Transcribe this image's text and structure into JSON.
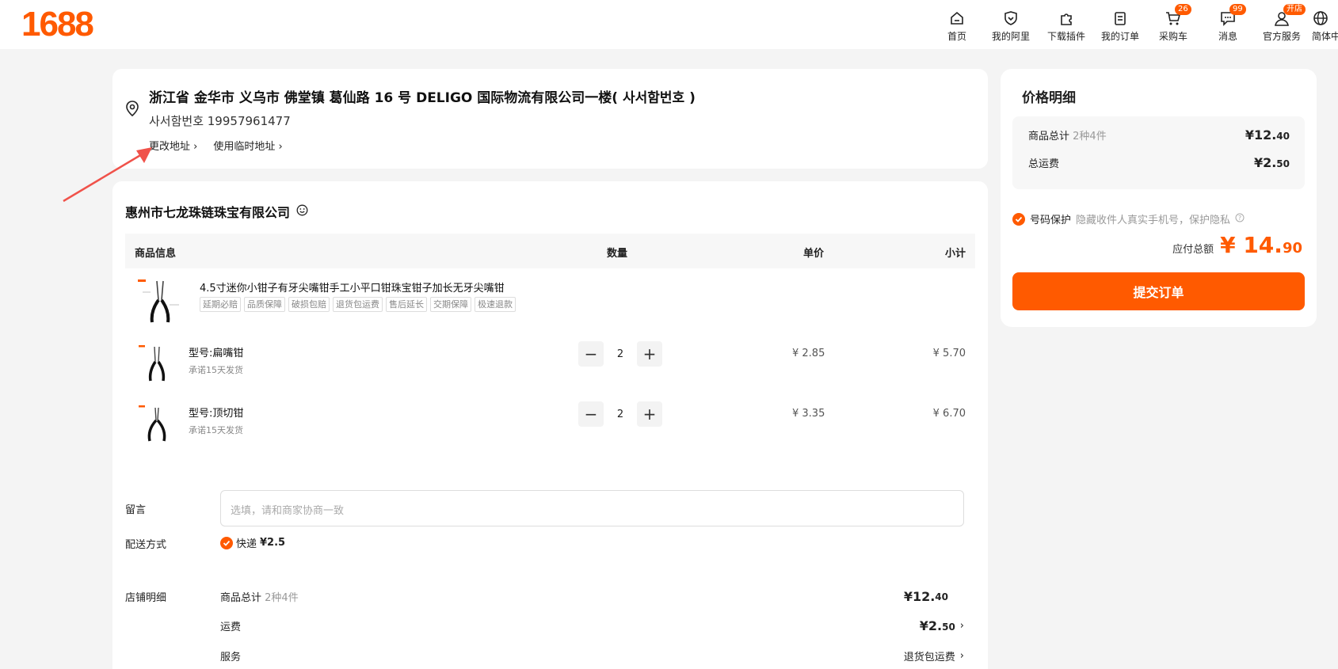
{
  "header": {
    "logo": "1688",
    "nav": [
      {
        "label": "首页",
        "icon": "home-icon"
      },
      {
        "label": "我的阿里",
        "icon": "heart-shield-icon"
      },
      {
        "label": "下载插件",
        "icon": "puzzle-icon"
      },
      {
        "label": "我的订单",
        "icon": "clipboard-icon"
      },
      {
        "label": "采购车",
        "icon": "cart-icon",
        "badge": "26"
      },
      {
        "label": "消息",
        "icon": "message-icon",
        "badge": "99"
      },
      {
        "label": "官方服务",
        "icon": "user-service-icon",
        "badge": "开店"
      },
      {
        "label": "简体中",
        "icon": "globe-icon"
      }
    ]
  },
  "address": {
    "full": "浙江省 金华市 义乌市 佛堂镇 葛仙路 16 号 DELIGO 国际物流有限公司一楼( 사서함번호 )",
    "contact": "사서함번호 19957961477",
    "change_link": "更改地址 ›",
    "temp_link": "使用临时地址 ›"
  },
  "shop": {
    "name": "惠州市七龙珠链珠宝有限公司",
    "columns": {
      "info": "商品信息",
      "qty": "数量",
      "unit": "单价",
      "subtotal": "小计"
    },
    "product": {
      "title": "4.5寸迷你小钳子有牙尖嘴钳手工小平口钳珠宝钳子加长无牙尖嘴钳",
      "tags": [
        "延期必赔",
        "品质保障",
        "破损包赔",
        "退货包运费",
        "售后延长",
        "交期保障",
        "极速退款"
      ]
    },
    "skus": [
      {
        "name": "型号:扁嘴钳",
        "promise": "承诺15天发货",
        "qty": "2",
        "unit_price": "¥ 2.85",
        "subtotal": "¥ 5.70"
      },
      {
        "name": "型号:顶切钳",
        "promise": "承诺15天发货",
        "qty": "2",
        "unit_price": "¥ 3.35",
        "subtotal": "¥ 6.70"
      }
    ],
    "note_label": "留言",
    "note_placeholder": "选填，请和商家协商一致",
    "shipping_label": "配送方式",
    "shipping_option": "快递",
    "shipping_price": "¥2.5",
    "detail_label": "店铺明细",
    "detail": {
      "goods_label": "商品总计",
      "goods_count": "2种4件",
      "goods_total_main": "¥12.",
      "goods_total_dec": "40",
      "freight_label": "运费",
      "freight_main": "¥2.",
      "freight_dec": "50",
      "service_label": "服务",
      "service_value": "退货包运费"
    }
  },
  "price_panel": {
    "title": "价格明细",
    "goods_label": "商品总计",
    "goods_count": "2种4件",
    "goods_main": "¥12.",
    "goods_dec": "40",
    "freight_label": "总运费",
    "freight_main": "¥2.",
    "freight_dec": "50",
    "protect_label": "号码保护",
    "protect_desc": "隐藏收件人真实手机号，保护隐私",
    "total_label": "应付总额",
    "total_main": "¥ 14.",
    "total_dec": "90",
    "submit": "提交订单"
  },
  "colors": {
    "brand": "#ff5a00",
    "annotation_arrow": "#f0524a"
  }
}
